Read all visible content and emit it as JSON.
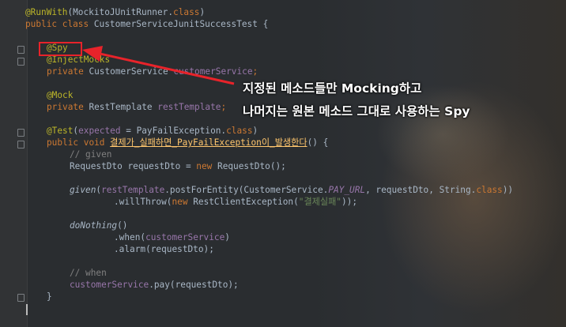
{
  "editor": {
    "lines": {
      "l1": {
        "annotation": "@RunWith",
        "open": "(",
        "runner": "MockitoJUnitRunner",
        "dot": ".",
        "class_kw": "class",
        "close": ")"
      },
      "l2": {
        "kw1": "public",
        "kw2": "class",
        "name": "CustomerServiceJunitSuccessTest {"
      },
      "l4": {
        "annotation": "@Spy"
      },
      "l5": {
        "annotation": "@InjectMocks"
      },
      "l6": {
        "kw": "private",
        "type": "CustomerService",
        "field": "customerService",
        "end": ";"
      },
      "l8": {
        "annotation": "@Mock"
      },
      "l9": {
        "kw": "private",
        "type": "RestTemplate",
        "field": "restTemplate",
        "end": ";"
      },
      "l11": {
        "annotation": "@Test",
        "open": "(",
        "param": "expected",
        "eq": " = PayFailException.",
        "class_kw": "class",
        "close": ")"
      },
      "l12": {
        "kw1": "public",
        "kw2": "void",
        "method": "결제가_실패하면_PayFailException이_발생한다",
        "rest": "() {"
      },
      "l13": {
        "comment": "// given"
      },
      "l14": {
        "pre": "RequestDto requestDto = ",
        "kw": "new",
        "post": " RequestDto();"
      },
      "l16": {
        "given": "given",
        "open": "(",
        "field": "restTemplate",
        "call": ".postForEntity(CustomerService.",
        "const": "PAY_URL",
        "rest": ", requestDto, String.",
        "class_kw": "class",
        "close": "))"
      },
      "l17": {
        "pre": ".willThrow(",
        "kw": "new",
        "mid": " RestClientException(",
        "str": "\"결제실패\"",
        "close": "));"
      },
      "l19": {
        "name": "doNothing",
        "rest": "()"
      },
      "l20": {
        "pre": ".when(",
        "field": "customerService",
        "close": ")"
      },
      "l21": {
        "text": ".alarm(requestDto);"
      },
      "l23": {
        "comment": "// when"
      },
      "l24": {
        "field": "customerService",
        "rest": ".pay(requestDto);"
      },
      "l25": {
        "text": "}"
      }
    }
  },
  "annotation_text": {
    "line1_prefix": "지정된 메소드들만 ",
    "line1_bold": "Mocking",
    "line1_suffix": "하고",
    "line2_prefix": "나머지는 원본 메소드 그대로 사용하는 ",
    "line2_bold": "Spy"
  },
  "colors": {
    "highlight": "#e8232a",
    "keyword": "#cc7832",
    "annotation": "#bbb529",
    "field": "#9876aa",
    "string": "#6a8759",
    "comment": "#808080",
    "method": "#ffc66d"
  }
}
